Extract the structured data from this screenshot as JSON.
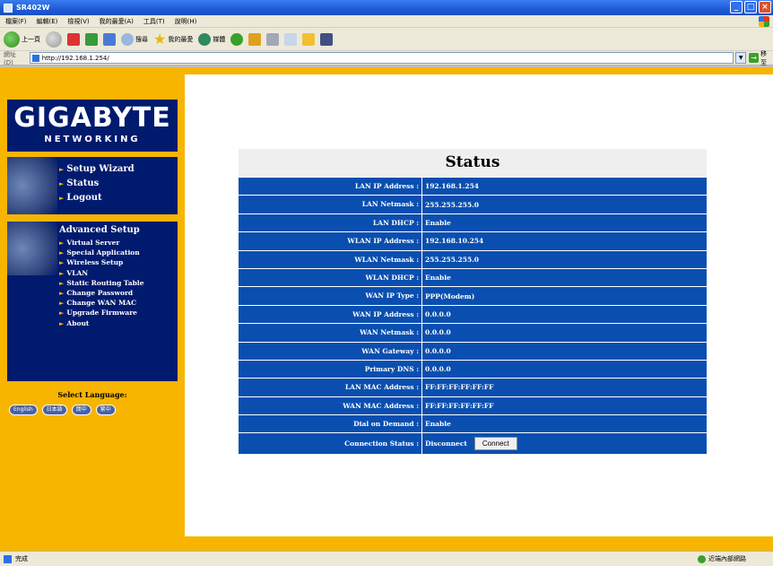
{
  "window": {
    "title": "SR402W"
  },
  "menu": [
    "檔案(F)",
    "編輯(E)",
    "檢視(V)",
    "我的最愛(A)",
    "工具(T)",
    "說明(H)"
  ],
  "toolbar": {
    "back": "上一頁",
    "search": "搜尋",
    "favorites": "我的最愛",
    "media": "媒體"
  },
  "address": {
    "label": "網址(D)",
    "url": "http://192.168.1.254/",
    "go": "移至"
  },
  "brand": {
    "name": "GIGABYTE",
    "sub": "NETWORKING"
  },
  "nav": {
    "basic": [
      {
        "label": "Setup Wizard"
      },
      {
        "label": "Status"
      },
      {
        "label": "Logout"
      }
    ],
    "advanced_title": "Advanced Setup",
    "advanced": [
      {
        "label": "Virtual Server"
      },
      {
        "label": "Special Application"
      },
      {
        "label": "Wireless Setup"
      },
      {
        "label": "VLAN"
      },
      {
        "label": "Static Routing Table"
      },
      {
        "label": "Change Password"
      },
      {
        "label": "Change WAN MAC"
      },
      {
        "label": "Upgrade Firmware"
      },
      {
        "label": "About"
      }
    ]
  },
  "language": {
    "title": "Select Language:",
    "options": [
      "English",
      "日本語",
      "簡中",
      "繁中"
    ]
  },
  "status": {
    "title": "Status",
    "rows": [
      {
        "label": "LAN IP Address :",
        "value": "192.168.1.254"
      },
      {
        "label": "LAN Netmask :",
        "value": "255.255.255.0"
      },
      {
        "label": "LAN DHCP :",
        "value": "Enable"
      },
      {
        "label": "WLAN IP Address :",
        "value": "192.168.10.254"
      },
      {
        "label": "WLAN Netmask :",
        "value": "255.255.255.0"
      },
      {
        "label": "WLAN DHCP :",
        "value": "Enable"
      },
      {
        "label": "WAN IP Type :",
        "value": "PPP(Modem)"
      },
      {
        "label": "WAN IP Address :",
        "value": "0.0.0.0"
      },
      {
        "label": "WAN Netmask :",
        "value": "0.0.0.0"
      },
      {
        "label": "WAN Gateway :",
        "value": "0.0.0.0"
      },
      {
        "label": "Primary DNS :",
        "value": "0.0.0.0"
      },
      {
        "label": "LAN MAC Address :",
        "value": "FF:FF:FF:FF:FF:FF"
      },
      {
        "label": "WAN MAC Address :",
        "value": "FF:FF:FF:FF:FF:FF"
      },
      {
        "label": "Dial on Demand :",
        "value": "Enable"
      }
    ],
    "connection": {
      "label": "Connection Status :",
      "value": "Disconnect",
      "button": "Connect"
    }
  },
  "statusbar": {
    "left": "完成",
    "right": "近端內部網路"
  },
  "colors": {
    "brand_navy": "#001a6e",
    "accent_yellow": "#f7b500",
    "table_blue": "#0a4fb0"
  }
}
